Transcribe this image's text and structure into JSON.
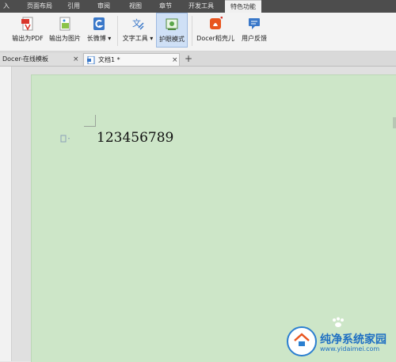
{
  "menu": {
    "tabs": [
      "入",
      "页面布局",
      "引用",
      "审阅",
      "视图",
      "章节",
      "开发工具",
      "特色功能"
    ],
    "active": "特色功能"
  },
  "ribbon": {
    "export_pdf": "输出为PDF",
    "export_image": "输出为图片",
    "long_weibo": "长微博",
    "text_tools": "文字工具",
    "eye_protection": "护眼模式",
    "docer_shell": "Docer稻壳儿",
    "user_feedback": "用户反馈",
    "dropdown_glyph": "▾"
  },
  "doc_tabs": {
    "tab1": "Docer-在线模板",
    "tab2": "文档1 *",
    "close_glyph": "×",
    "new_glyph": "+"
  },
  "document": {
    "text": "123456789"
  },
  "watermark": {
    "title": "纯净系统家园",
    "url": "www.yidaimei.com"
  },
  "colors": {
    "page_background": "#cde6c8",
    "menubar": "#4d4d4d",
    "watermark_blue": "#1e6fc3",
    "pdf_red": "#d9362b"
  }
}
